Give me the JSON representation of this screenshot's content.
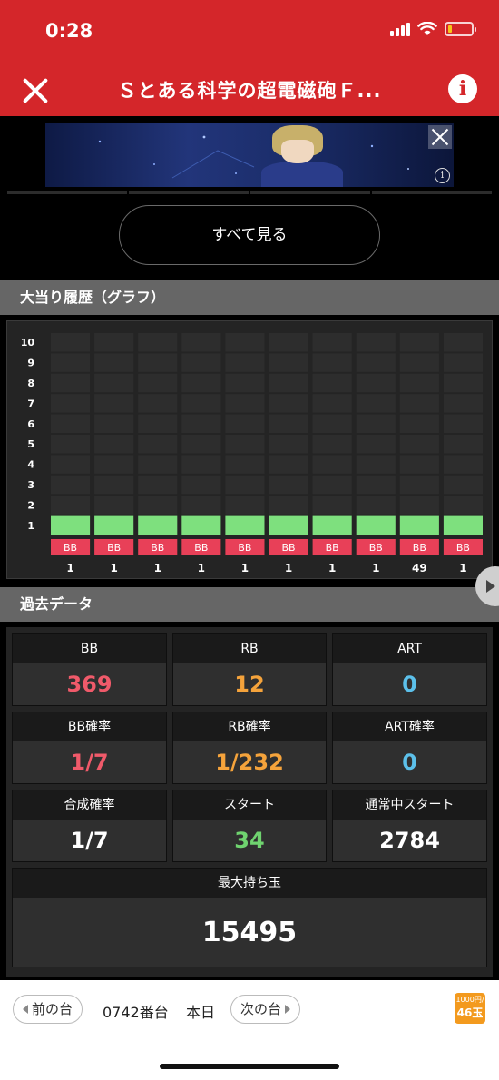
{
  "status_bar": {
    "time": "0:28",
    "battery_level": 0.15
  },
  "nav": {
    "title": "Ｓとある科学の超電磁砲Ｆ...",
    "close_icon": "close-icon",
    "info_icon": "info-icon"
  },
  "ad": {
    "close_icon": "ad-close-icon",
    "info_icon": "ad-info-icon"
  },
  "see_all_label": "すべて見る",
  "graph_section": {
    "title": "大当り履歴（グラフ）"
  },
  "chart_data": {
    "type": "bar",
    "title": "",
    "xlabel": "",
    "ylabel": "",
    "y_ticks": [
      "10",
      "9",
      "8",
      "7",
      "6",
      "5",
      "4",
      "3",
      "2",
      "1"
    ],
    "ylim": [
      0,
      10
    ],
    "bar_color": "#7ee07e",
    "tag_color": "#e84058",
    "categories": [
      "1",
      "1",
      "1",
      "1",
      "1",
      "1",
      "1",
      "1",
      "49",
      "1"
    ],
    "tags": [
      "BB",
      "BB",
      "BB",
      "BB",
      "BB",
      "BB",
      "BB",
      "BB",
      "BB",
      "BB"
    ],
    "values": [
      1,
      1,
      1,
      1,
      1,
      1,
      1,
      1,
      1,
      1
    ]
  },
  "past_section": {
    "title": "過去データ"
  },
  "stats": {
    "bb": {
      "label": "BB",
      "value": "369",
      "color": "#f05a6a"
    },
    "rb": {
      "label": "RB",
      "value": "12",
      "color": "#f5a33b"
    },
    "art": {
      "label": "ART",
      "value": "0",
      "color": "#5cc0ea"
    },
    "bb_rate": {
      "label": "BB確率",
      "value": "1/7",
      "color": "#f05a6a"
    },
    "rb_rate": {
      "label": "RB確率",
      "value": "1/232",
      "color": "#f5a33b"
    },
    "art_rate": {
      "label": "ART確率",
      "value": "0",
      "color": "#5cc0ea"
    },
    "combined_rate": {
      "label": "合成確率",
      "value": "1/7",
      "color": "#ffffff"
    },
    "start": {
      "label": "スタート",
      "value": "34",
      "color": "#6fd36f"
    },
    "normal_start": {
      "label": "通常中スタート",
      "value": "2784",
      "color": "#ffffff"
    },
    "max_balls": {
      "label": "最大持ち玉",
      "value": "15495",
      "color": "#ffffff"
    }
  },
  "bottom_bar": {
    "prev_label": "前の台",
    "machine_number": "0742番台",
    "day": "本日",
    "next_label": "次の台",
    "rate_top": "1000円/",
    "rate_bottom": "46玉"
  }
}
